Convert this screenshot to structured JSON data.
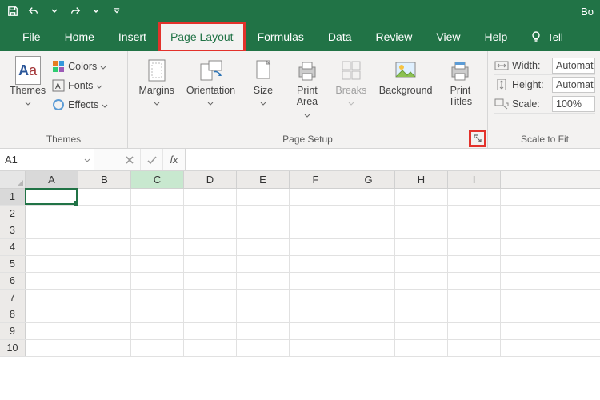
{
  "titlebar": {
    "doc": "Bo"
  },
  "tabs": {
    "file": "File",
    "home": "Home",
    "insert": "Insert",
    "page_layout": "Page Layout",
    "formulas": "Formulas",
    "data": "Data",
    "review": "Review",
    "view": "View",
    "help": "Help",
    "tell": "Tell"
  },
  "ribbon": {
    "themes": {
      "label": "Themes",
      "themes_btn": "Themes",
      "colors": "Colors",
      "fonts": "Fonts",
      "effects": "Effects"
    },
    "page_setup": {
      "label": "Page Setup",
      "margins": "Margins",
      "orientation": "Orientation",
      "size": "Size",
      "print_area": "Print\nArea",
      "breaks": "Breaks",
      "background": "Background",
      "print_titles": "Print\nTitles"
    },
    "scale_to_fit": {
      "label": "Scale to Fit",
      "width_label": "Width:",
      "width_value": "Automat",
      "height_label": "Height:",
      "height_value": "Automat",
      "scale_label": "Scale:",
      "scale_value": "100%"
    }
  },
  "formula_bar": {
    "namebox_value": "A1",
    "fx_label": "fx",
    "formula_value": ""
  },
  "grid": {
    "columns": [
      "A",
      "B",
      "C",
      "D",
      "E",
      "F",
      "G",
      "H",
      "I"
    ],
    "rows": [
      "1",
      "2",
      "3",
      "4",
      "5",
      "6",
      "7",
      "8",
      "9",
      "10"
    ],
    "selected_col": "A",
    "green_col": "C",
    "selected_row": "1",
    "active_cell": "A1"
  }
}
